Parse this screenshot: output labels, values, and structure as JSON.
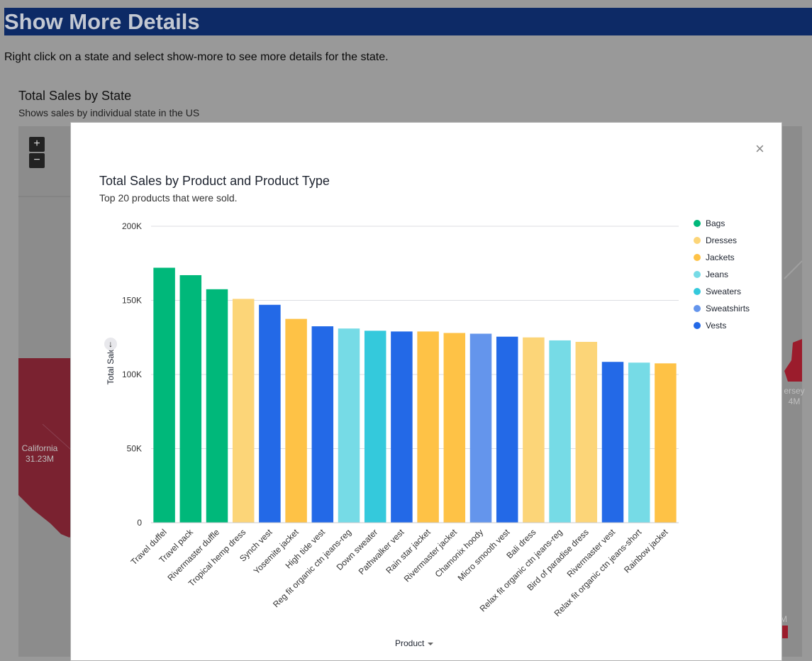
{
  "page": {
    "title": "Show More Details",
    "intro": "Right click on a state and select show-more to see more details for the state.",
    "colors": {
      "banner": "#0d2a66",
      "overlay": "#999999",
      "map_state": "#7a2230"
    }
  },
  "background_chart": {
    "title": "Total Sales by State",
    "subtitle": "Shows sales by individual state in the US",
    "zoom_in": "+",
    "zoom_out": "−",
    "labels": [
      {
        "name": "California",
        "value": "31.23M"
      },
      {
        "name": "ersey",
        "value": "4M"
      },
      {
        "name": "M",
        "value": ""
      }
    ]
  },
  "modal": {
    "close": "×",
    "sort_icon": "↓"
  },
  "chart_data": {
    "type": "bar",
    "title": "Total Sales by Product and Product Type",
    "subtitle": "Top 20 products that were sold.",
    "xlabel": "Product",
    "ylabel": "Total Sales",
    "ylim": [
      0,
      200000
    ],
    "yticks": [
      {
        "value": 0,
        "label": "0"
      },
      {
        "value": 50000,
        "label": "50K"
      },
      {
        "value": 100000,
        "label": "100K"
      },
      {
        "value": 150000,
        "label": "150K"
      },
      {
        "value": 200000,
        "label": "200K"
      }
    ],
    "grid": true,
    "legend_position": "right",
    "legend": [
      {
        "name": "Bags",
        "color": "#00b87a"
      },
      {
        "name": "Dresses",
        "color": "#fcd578"
      },
      {
        "name": "Jackets",
        "color": "#fec246"
      },
      {
        "name": "Jeans",
        "color": "#76dbe6"
      },
      {
        "name": "Sweaters",
        "color": "#34c9dc"
      },
      {
        "name": "Sweatshirts",
        "color": "#6495ec"
      },
      {
        "name": "Vests",
        "color": "#2369e7"
      }
    ],
    "bars": [
      {
        "product": "Travel duffel",
        "type": "Bags",
        "value": 172000
      },
      {
        "product": "Travel pack",
        "type": "Bags",
        "value": 167000
      },
      {
        "product": "Rivermaster duffle",
        "type": "Bags",
        "value": 157500
      },
      {
        "product": "Tropical hemp dress",
        "type": "Dresses",
        "value": 151000
      },
      {
        "product": "Synch vest",
        "type": "Vests",
        "value": 147000
      },
      {
        "product": "Yosemite jacket",
        "type": "Jackets",
        "value": 137500
      },
      {
        "product": "High tide vest",
        "type": "Vests",
        "value": 132500
      },
      {
        "product": "Reg fit organic ctn jeans-reg",
        "type": "Jeans",
        "value": 131000
      },
      {
        "product": "Down sweater",
        "type": "Sweaters",
        "value": 129500
      },
      {
        "product": "Pathwalker vest",
        "type": "Vests",
        "value": 129000
      },
      {
        "product": "Rain star jacket",
        "type": "Jackets",
        "value": 129000
      },
      {
        "product": "Rivermaster jacket",
        "type": "Jackets",
        "value": 128000
      },
      {
        "product": "Chamonix hoody",
        "type": "Sweatshirts",
        "value": 127500
      },
      {
        "product": "Micro smooth vest",
        "type": "Vests",
        "value": 125500
      },
      {
        "product": "Bali dress",
        "type": "Dresses",
        "value": 125000
      },
      {
        "product": "Relax fit organic ctn jeans-reg",
        "type": "Jeans",
        "value": 123000
      },
      {
        "product": "Bird of paradise dress",
        "type": "Dresses",
        "value": 122000
      },
      {
        "product": "Rivermaster vest",
        "type": "Vests",
        "value": 108500
      },
      {
        "product": "Relax fit organic ctn jeans-short",
        "type": "Jeans",
        "value": 108000
      },
      {
        "product": "Rainbow jacket",
        "type": "Jackets",
        "value": 107500
      }
    ]
  }
}
